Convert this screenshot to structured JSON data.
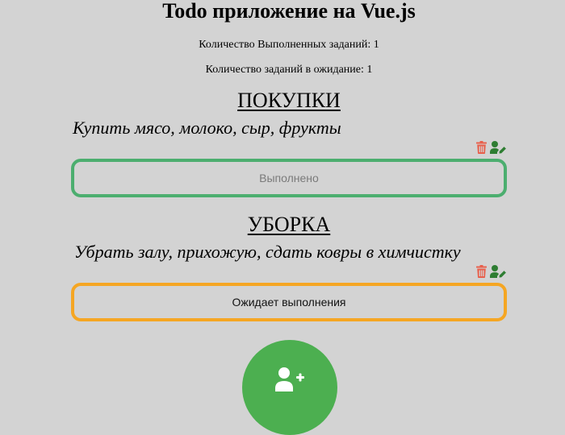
{
  "header": {
    "title": "Todo приложение на Vue.js"
  },
  "stats": {
    "done_text": "Количество Выполненных заданий: 1",
    "pending_text": "Количество заданий в ожидание: 1"
  },
  "tasks": [
    {
      "title": "ПОКУПКИ",
      "description": "Купить мясо, молоко, сыр, фрукты",
      "status_label": "Выполнено",
      "status_color": "#4cae6f",
      "actions": [
        "trash-icon",
        "user-edit-icon"
      ]
    },
    {
      "title": "УБОРКА",
      "description": "Убрать залу, прихожую, сдать ковры в химчистку",
      "status_label": "Ожидает выполнения",
      "status_color": "#f5a623",
      "actions": [
        "trash-icon",
        "user-edit-icon"
      ]
    }
  ],
  "add_button": {
    "icon": "user-plus-icon",
    "color": "#4caf50"
  },
  "colors": {
    "background": "#d3d3d3",
    "delete_icon": "#e8604c",
    "edit_icon": "#2e7d32"
  }
}
